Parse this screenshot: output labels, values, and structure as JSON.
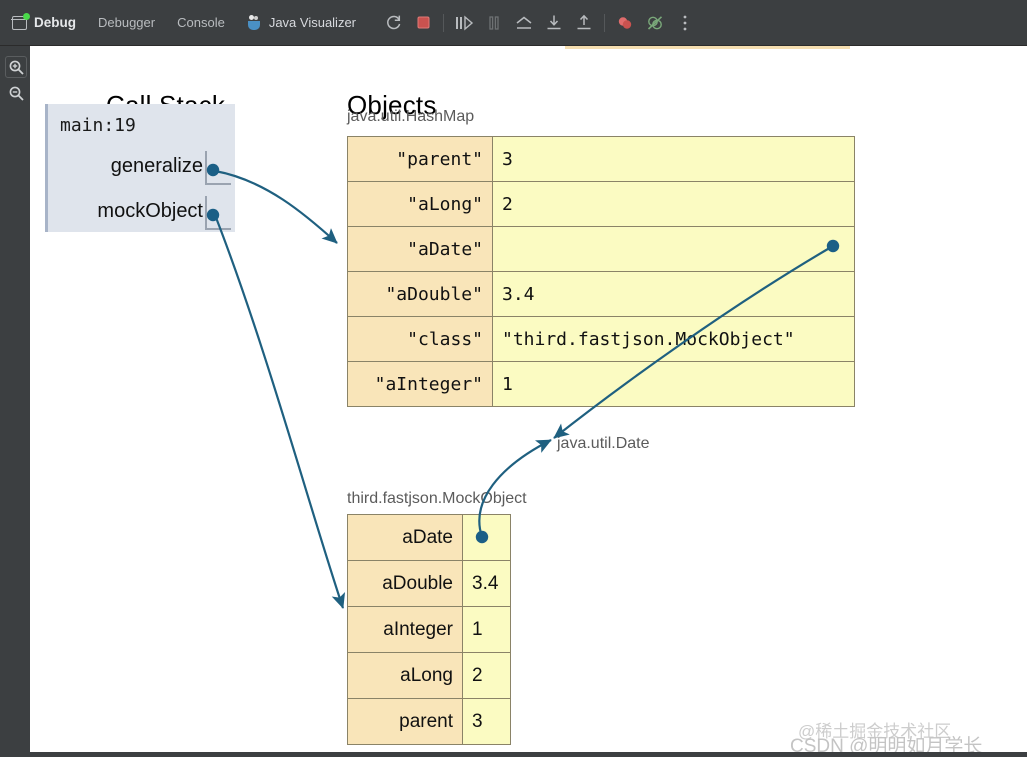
{
  "window": {
    "debug_tab_label": "Debug",
    "tabs": [
      {
        "label": "Debugger"
      },
      {
        "label": "Console"
      }
    ],
    "java_visualizer_label": "Java Visualizer",
    "toolbar_icons": [
      {
        "name": "rerun-icon",
        "glyph": "↻"
      },
      {
        "name": "stop-icon",
        "glyph": "■"
      },
      {
        "name": "step-forward-icon",
        "glyph": "▷"
      },
      {
        "name": "pause-icon",
        "glyph": "‖"
      },
      {
        "name": "step-out-icon",
        "glyph": "⌃"
      },
      {
        "name": "step-into-icon",
        "glyph": "↓"
      },
      {
        "name": "step-over-icon",
        "glyph": "↑"
      },
      {
        "name": "breakpoints-icon",
        "glyph": "●"
      },
      {
        "name": "mute-breakpoints-icon",
        "glyph": "⊘"
      },
      {
        "name": "more-options-icon",
        "glyph": "⋮"
      }
    ],
    "gutter": [
      {
        "name": "zoom-in-icon",
        "glyph": "+"
      },
      {
        "name": "zoom-out-icon",
        "glyph": "−"
      }
    ]
  },
  "headings": {
    "call_stack": "Call Stack",
    "objects": "Objects"
  },
  "call_stack": {
    "frame_name": "main:19",
    "slots": [
      {
        "label": "generalize"
      },
      {
        "label": "mockObject"
      }
    ]
  },
  "objects": {
    "hashmap": {
      "title": "java.util.HashMap",
      "rows": [
        {
          "key": "\"parent\"",
          "value": "3"
        },
        {
          "key": "\"aLong\"",
          "value": "2"
        },
        {
          "key": "\"aDate\"",
          "value": ""
        },
        {
          "key": "\"aDouble\"",
          "value": "3.4"
        },
        {
          "key": "\"class\"",
          "value": "\"third.fastjson.MockObject\""
        },
        {
          "key": "\"aInteger\"",
          "value": "1"
        }
      ]
    },
    "mockobject": {
      "title": "third.fastjson.MockObject",
      "rows": [
        {
          "key": "aDate",
          "value": ""
        },
        {
          "key": "aDouble",
          "value": "3.4"
        },
        {
          "key": "aInteger",
          "value": "1"
        },
        {
          "key": "aLong",
          "value": "2"
        },
        {
          "key": "parent",
          "value": "3"
        }
      ]
    },
    "date_label": "java.util.Date"
  },
  "watermarks": {
    "line1": "@稀土掘金技术社区",
    "line2": "CSDN @明明如月学长"
  },
  "colors": {
    "toolbar_bg": "#3c3f41",
    "frame_bg": "#dfe4ec",
    "key_cell": "#f9e5b9",
    "value_cell": "#fbfbc2",
    "arrow": "#1f6080",
    "accent_amber": "#f5deb0"
  }
}
